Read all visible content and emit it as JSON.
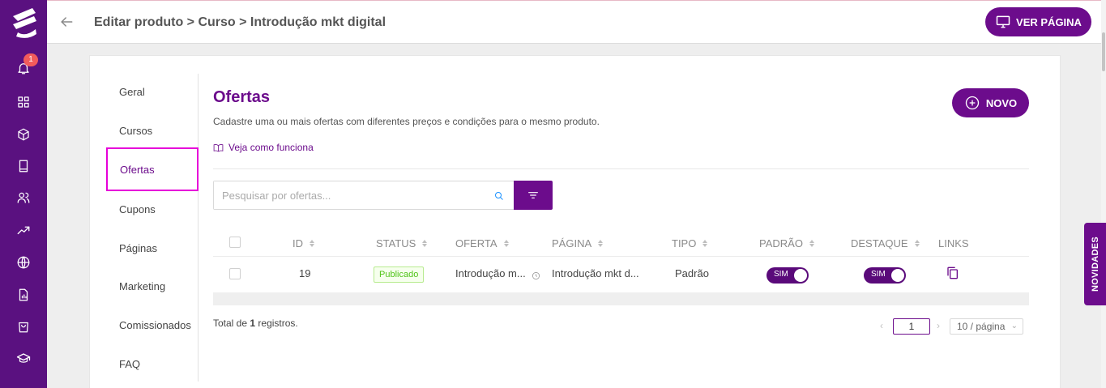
{
  "header": {
    "breadcrumb": "Editar produto > Curso > Introdução mkt digital",
    "view_page_label": "VER PÁGINA"
  },
  "notifications": {
    "badge_count": "1"
  },
  "nav": {
    "items": [
      {
        "label": "Geral"
      },
      {
        "label": "Cursos"
      },
      {
        "label": "Ofertas"
      },
      {
        "label": "Cupons"
      },
      {
        "label": "Páginas"
      },
      {
        "label": "Marketing"
      },
      {
        "label": "Comissionados"
      },
      {
        "label": "FAQ"
      }
    ],
    "active": "Ofertas"
  },
  "content": {
    "title": "Ofertas",
    "description": "Cadastre uma ou mais ofertas com diferentes preços e condições para o mesmo produto.",
    "how_it_works": "Veja como funciona",
    "new_button": "NOVO",
    "search_placeholder": "Pesquisar por ofertas..."
  },
  "table": {
    "columns": [
      "ID",
      "STATUS",
      "OFERTA",
      "PÁGINA",
      "TIPO",
      "PADRÃO",
      "DESTAQUE",
      "LINKS"
    ],
    "rows": [
      {
        "id": "19",
        "status": "Publicado",
        "offer": "Introdução m...",
        "page": "Introdução mkt d...",
        "type": "Padrão",
        "default": "SIM",
        "highlight": "SIM"
      }
    ]
  },
  "footer": {
    "total_prefix": "Total de ",
    "total_count": "1",
    "total_suffix": " registros."
  },
  "pagination": {
    "current_page": "1",
    "page_size": "10 / página"
  },
  "side_tab": {
    "label": "NOVIDADES"
  },
  "colors": {
    "primary": "#6c0c8c",
    "sidebar": "#5a1180",
    "badge": "#f25b5b",
    "highlight_outline": "#e600d9",
    "status_green": "#52c41a"
  },
  "icons": {
    "rail": [
      "logo",
      "bell-icon",
      "grid-icon",
      "box-icon",
      "book-icon",
      "users-icon",
      "trending-up-icon",
      "globe-icon",
      "report-icon",
      "shopping-bag-icon",
      "graduation-cap-icon"
    ]
  }
}
